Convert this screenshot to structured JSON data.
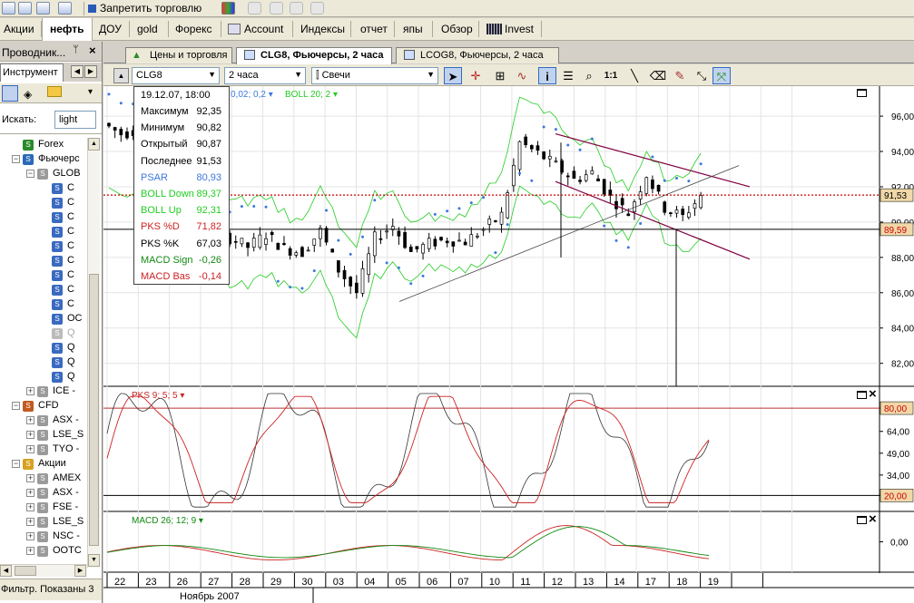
{
  "toolbar": {
    "forbid_trading": "Запретить торговлю"
  },
  "main_tabs": [
    "Акции",
    "нефть",
    "ДОУ",
    "gold",
    "Форекс",
    "Account",
    "Индексы",
    "отчет",
    "япы",
    "Обзор",
    "Invest"
  ],
  "left_panel": {
    "title": "Проводник...",
    "tab_instrument": "Инструмент",
    "search_label": "Искать:",
    "search_value": "light",
    "footer": "Фильтр. Показаны 3",
    "tree": [
      {
        "label": "Forex",
        "level": 1,
        "exp": ""
      },
      {
        "label": "Фьючерс",
        "level": 1,
        "exp": "-"
      },
      {
        "label": "GLOB",
        "level": 2,
        "exp": "-"
      },
      {
        "label": "C",
        "level": 3
      },
      {
        "label": "C",
        "level": 3
      },
      {
        "label": "C",
        "level": 3
      },
      {
        "label": "C",
        "level": 3
      },
      {
        "label": "C",
        "level": 3
      },
      {
        "label": "C",
        "level": 3
      },
      {
        "label": "C",
        "level": 3
      },
      {
        "label": "C",
        "level": 3
      },
      {
        "label": "C",
        "level": 3
      },
      {
        "label": "OC",
        "level": 3
      },
      {
        "label": "Q",
        "level": 3,
        "dis": true
      },
      {
        "label": "Q",
        "level": 3
      },
      {
        "label": "Q",
        "level": 3
      },
      {
        "label": "Q",
        "level": 3
      },
      {
        "label": "ICE -",
        "level": 2,
        "exp": "+"
      },
      {
        "label": "CFD",
        "level": 1,
        "exp": "-"
      },
      {
        "label": "ASX -",
        "level": 2,
        "exp": "+"
      },
      {
        "label": "LSE_S",
        "level": 2,
        "exp": "+"
      },
      {
        "label": "TYO -",
        "level": 2,
        "exp": "+"
      },
      {
        "label": "Акции",
        "level": 1,
        "exp": "-"
      },
      {
        "label": "AMEX",
        "level": 2,
        "exp": "+"
      },
      {
        "label": "ASX -",
        "level": 2,
        "exp": "+"
      },
      {
        "label": "FSE -",
        "level": 2,
        "exp": "+"
      },
      {
        "label": "LSE_S",
        "level": 2,
        "exp": "+"
      },
      {
        "label": "NSC -",
        "level": 2,
        "exp": "+"
      },
      {
        "label": "OOTC",
        "level": 2,
        "exp": "+"
      }
    ]
  },
  "chart_tabs": [
    {
      "label": "Цены и торговля",
      "active": false
    },
    {
      "label": "CLG8, Фьючерсы, 2 часа",
      "active": true
    },
    {
      "label": "LCOG8, Фьючерсы, 2 часа",
      "active": false
    }
  ],
  "chart_toolbar": {
    "symbol": "CLG8",
    "period": "2 часа",
    "chart_style": "Свечи"
  },
  "tooltip": {
    "datetime": "19.12.07, 18:00",
    "rows": [
      {
        "label": "Максимум",
        "value": "92,35",
        "color": "#000000"
      },
      {
        "label": "Минимум",
        "value": "90,82",
        "color": "#000000"
      },
      {
        "label": "Открытый",
        "value": "90,87",
        "color": "#000000"
      },
      {
        "label": "Последнее",
        "value": "91,53",
        "color": "#000000"
      },
      {
        "label": "PSAR",
        "value": "80,93",
        "color": "#3c78dc"
      },
      {
        "label": "BOLL Down",
        "value": "89,37",
        "color": "#22cc22"
      },
      {
        "label": "BOLL Up",
        "value": "92,31",
        "color": "#22cc22"
      },
      {
        "label": "PKS %D",
        "value": "71,82",
        "color": "#cc2222"
      },
      {
        "label": "PKS %K",
        "value": "67,03",
        "color": "#000000"
      },
      {
        "label": "MACD Sign",
        "value": "-0,26",
        "color": "#118811"
      },
      {
        "label": "MACD Bas",
        "value": "-0,14",
        "color": "#cc2222"
      }
    ]
  },
  "indicator_labels": {
    "psar_partial": "0,02; 0,2",
    "boll": "BOLL 20; 2",
    "pks": "PKS 9; 5; 5",
    "macd": "MACD 26; 12; 9"
  },
  "colors": {
    "price_label_bg": "#f0d8a8",
    "boll": "#22cc22",
    "psar": "#3c78dc",
    "channel": "#800040"
  },
  "chart_data": [
    {
      "type": "line",
      "title": "CLG8, Фьючерсы, 2 часа",
      "panel": "price",
      "y_ticks": [
        "96,00",
        "94,00",
        "92,00",
        "90,00",
        "88,00",
        "86,00",
        "84,00",
        "82,00"
      ],
      "ylim": [
        80.7,
        97.7
      ],
      "price_labels": [
        "91,53",
        "89,59"
      ],
      "series": [
        {
          "name": "Последнее",
          "values": [
            95.6,
            95.0,
            95.2,
            93.3,
            92.4,
            90.6,
            89.8,
            89.1,
            88.6,
            89.3,
            88.5,
            88.3,
            89.5,
            87.3,
            86.0,
            89.1,
            89.8,
            88.3,
            88.8,
            89.0,
            88.9,
            89.6,
            90.4,
            94.5,
            93.9,
            93.2,
            92.4,
            92.8,
            91.4,
            90.5,
            92.7,
            90.8,
            90.3,
            91.5
          ]
        }
      ]
    },
    {
      "type": "line",
      "panel": "PKS 9; 5; 5",
      "y_ticks": [
        "80,00",
        "64,00",
        "49,00",
        "34,00",
        "20,00"
      ],
      "ylim": [
        9,
        95
      ]
    },
    {
      "type": "line",
      "panel": "MACD 26; 12; 9",
      "y_ticks": [
        "0,00"
      ],
      "ylim": [
        -2.5,
        2.5
      ]
    }
  ],
  "x_axis": {
    "days": [
      "22",
      "23",
      "26",
      "27",
      "28",
      "29",
      "30",
      "03",
      "04",
      "05",
      "06",
      "07",
      "10",
      "11",
      "12",
      "13",
      "14",
      "17",
      "18",
      "19"
    ],
    "month": "Ноябрь 2007"
  }
}
